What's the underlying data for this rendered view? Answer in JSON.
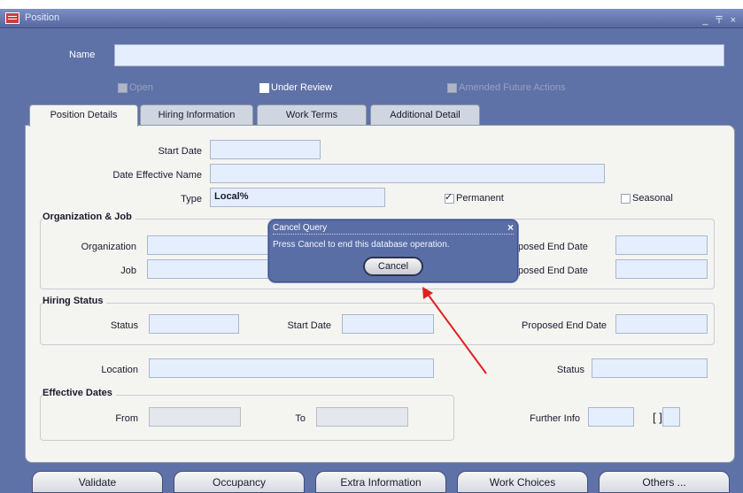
{
  "window": {
    "title": "Position",
    "controls": "_ 〒 ×"
  },
  "header": {
    "name_label": "Name",
    "name_value": "",
    "checkbox_left": "Open",
    "under_review": "Under Review",
    "checkbox_right": "Amended Future Actions"
  },
  "tabs": [
    "Position Details",
    "Hiring Information",
    "Work Terms",
    "Additional Detail"
  ],
  "position_details": {
    "start_date_label": "Start Date",
    "date_effective_name_label": "Date Effective Name",
    "type_label": "Type",
    "type_value": "Local%",
    "permanent_label": "Permanent",
    "seasonal_label": "Seasonal"
  },
  "org_job": {
    "title": "Organization & Job",
    "organization_label": "Organization",
    "job_label": "Job",
    "proposed_end_date_label_1": "posed End Date",
    "proposed_end_date_label_2": "posed End Date"
  },
  "hiring_status": {
    "title": "Hiring Status",
    "status_label": "Status",
    "start_date_label": "Start Date",
    "proposed_end_date_label": "Proposed End Date"
  },
  "location": {
    "location_label": "Location",
    "status_label": "Status"
  },
  "effective_dates": {
    "title": "Effective Dates",
    "from_label": "From",
    "to_label": "To",
    "further_info_label": "Further Info",
    "bracket_text": "[ ]"
  },
  "dialog": {
    "title": "Cancel Query",
    "close_icon": "×",
    "message": "Press Cancel to end this database operation.",
    "button_label": "Cancel"
  },
  "bottom_buttons": [
    "Validate",
    "Occupancy",
    "Extra Information",
    "Work Choices",
    "Others ..."
  ],
  "colors": {
    "window_bg": "#5f72a8",
    "panel_bg": "#f4f4f1",
    "field_bg": "#e5eefc",
    "arrow": "#e02020"
  }
}
